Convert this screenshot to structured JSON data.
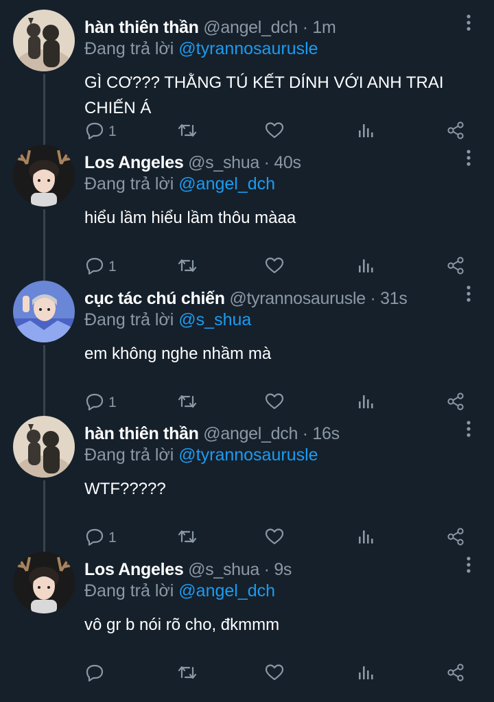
{
  "reply_prefix": "Đang trả lời",
  "tweets": [
    {
      "name": "hàn thiên thần",
      "handle": "@angel_dch",
      "time": "1m",
      "replying_to": "@tyrannosaurusle",
      "content": "GÌ CƠ??? THẰNG TÚ KẾT DÍNH VỚI ANH TRAI CHIẾN Á",
      "reply_count": "1",
      "avatar": "silhouette"
    },
    {
      "name": "Los Angeles",
      "handle": "@s_shua",
      "time": "40s",
      "replying_to": "@angel_dch",
      "content": "hiểu lầm hiểu lầm thôu màaa",
      "reply_count": "1",
      "avatar": "antler-boy"
    },
    {
      "name": "cục tác chú chiến",
      "handle": "@tyrannosaurusle",
      "time": "31s",
      "replying_to": "@s_shua",
      "content": "em không nghe nhầm mà",
      "reply_count": "1",
      "avatar": "blue-boy"
    },
    {
      "name": "hàn thiên thần",
      "handle": "@angel_dch",
      "time": "16s",
      "replying_to": "@tyrannosaurusle",
      "content": "WTF?????",
      "reply_count": "1",
      "avatar": "silhouette"
    },
    {
      "name": "Los Angeles",
      "handle": "@s_shua",
      "time": "9s",
      "replying_to": "@angel_dch",
      "content": "vô gr b nói rõ cho, đkmmm",
      "reply_count": "",
      "avatar": "antler-boy"
    }
  ],
  "theme": {
    "background": "#15202b",
    "primary_text": "#ffffff",
    "secondary_text": "#8b98a5",
    "link": "#1d9bf0",
    "thread_line": "#38444d"
  },
  "icons": {
    "reply": "reply-icon",
    "retweet": "retweet-icon",
    "like": "heart-icon",
    "views": "analytics-icon",
    "share": "share-icon",
    "more": "more-vertical-icon"
  }
}
